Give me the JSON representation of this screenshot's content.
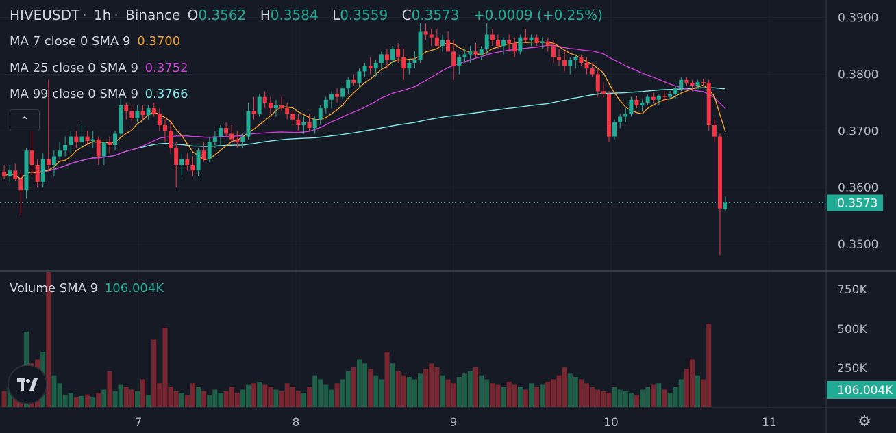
{
  "header": {
    "symbol": "HIVEUSDT",
    "interval": "1h",
    "exchange": "Binance",
    "o_label": "O",
    "open": "0.3562",
    "h_label": "H",
    "high": "0.3584",
    "l_label": "L",
    "low": "0.3559",
    "c_label": "C",
    "close": "0.3573",
    "change": "+0.0009 (+0.25%)"
  },
  "indicators": {
    "ma7": {
      "label": "MA 7 close 0 SMA 9",
      "value": "0.3700",
      "color": "#f0a030"
    },
    "ma25": {
      "label": "MA 25 close 0 SMA 9",
      "value": "0.3752",
      "color": "#d040d8"
    },
    "ma99": {
      "label": "MA 99 close 0 SMA 9",
      "value": "0.3766",
      "color": "#7fe8e8"
    },
    "volume": {
      "label": "Volume SMA 9",
      "value": "106.004K",
      "color": "#22ab94"
    }
  },
  "colors": {
    "up": "#22ab94",
    "down": "#f23645",
    "up_vol": "#1e5f48",
    "down_vol": "#7a2630",
    "bg": "#161a25",
    "grid": "#1f2330"
  },
  "icons": {
    "collapse": "chevron-up-icon",
    "logo": "tradingview-logo-icon",
    "settings": "gear-icon"
  },
  "chart_data": {
    "type": "candlestick",
    "price_axis": {
      "ticks": [
        "0.3900",
        "0.3800",
        "0.3700",
        "0.3600",
        "0.3500"
      ],
      "range": [
        0.3454,
        0.3931
      ],
      "last_price_label": "0.3573"
    },
    "volume_axis": {
      "ticks": [
        "750K",
        "500K",
        "250K"
      ],
      "range": [
        0,
        850000
      ],
      "last_volume_label": "106.004K"
    },
    "x_axis": {
      "ticks": [
        "7",
        "8",
        "9",
        "10",
        "11"
      ]
    },
    "candles": [
      [
        0.3628,
        0.364,
        0.3615,
        0.362
      ],
      [
        0.362,
        0.364,
        0.361,
        0.363
      ],
      [
        0.363,
        0.3642,
        0.3612,
        0.3615
      ],
      [
        0.3615,
        0.363,
        0.355,
        0.3595
      ],
      [
        0.3595,
        0.367,
        0.358,
        0.3665
      ],
      [
        0.3665,
        0.37,
        0.362,
        0.364
      ],
      [
        0.364,
        0.365,
        0.36,
        0.361
      ],
      [
        0.361,
        0.366,
        0.36,
        0.365
      ],
      [
        0.365,
        0.379,
        0.363,
        0.364
      ],
      [
        0.364,
        0.3665,
        0.362,
        0.3655
      ],
      [
        0.3655,
        0.368,
        0.365,
        0.3665
      ],
      [
        0.3665,
        0.369,
        0.3655,
        0.3675
      ],
      [
        0.3675,
        0.37,
        0.366,
        0.369
      ],
      [
        0.369,
        0.37,
        0.367,
        0.368
      ],
      [
        0.368,
        0.371,
        0.367,
        0.369
      ],
      [
        0.369,
        0.37,
        0.3675,
        0.3682
      ],
      [
        0.3682,
        0.37,
        0.367,
        0.3685
      ],
      [
        0.3685,
        0.369,
        0.364,
        0.3655
      ],
      [
        0.3655,
        0.368,
        0.364,
        0.368
      ],
      [
        0.368,
        0.369,
        0.366,
        0.3675
      ],
      [
        0.3675,
        0.37,
        0.3665,
        0.3695
      ],
      [
        0.3695,
        0.376,
        0.369,
        0.3745
      ],
      [
        0.3745,
        0.375,
        0.372,
        0.3735
      ],
      [
        0.3735,
        0.3745,
        0.3715,
        0.3722
      ],
      [
        0.3722,
        0.3745,
        0.3715,
        0.3735
      ],
      [
        0.3735,
        0.3745,
        0.372,
        0.3728
      ],
      [
        0.3728,
        0.3745,
        0.372,
        0.374
      ],
      [
        0.374,
        0.375,
        0.3725,
        0.373
      ],
      [
        0.373,
        0.374,
        0.37,
        0.371
      ],
      [
        0.371,
        0.372,
        0.368,
        0.37
      ],
      [
        0.37,
        0.3715,
        0.366,
        0.367
      ],
      [
        0.367,
        0.368,
        0.36,
        0.364
      ],
      [
        0.364,
        0.366,
        0.362,
        0.365
      ],
      [
        0.365,
        0.366,
        0.363,
        0.364
      ],
      [
        0.364,
        0.3655,
        0.362,
        0.363
      ],
      [
        0.363,
        0.367,
        0.362,
        0.3665
      ],
      [
        0.3665,
        0.368,
        0.3645,
        0.365
      ],
      [
        0.365,
        0.369,
        0.3645,
        0.368
      ],
      [
        0.368,
        0.37,
        0.367,
        0.369
      ],
      [
        0.369,
        0.371,
        0.3675,
        0.3705
      ],
      [
        0.3705,
        0.3715,
        0.369,
        0.3695
      ],
      [
        0.3695,
        0.371,
        0.368,
        0.3685
      ],
      [
        0.3685,
        0.37,
        0.367,
        0.368
      ],
      [
        0.368,
        0.3695,
        0.367,
        0.369
      ],
      [
        0.369,
        0.375,
        0.3685,
        0.3735
      ],
      [
        0.3735,
        0.376,
        0.372,
        0.373
      ],
      [
        0.373,
        0.3765,
        0.3725,
        0.376
      ],
      [
        0.376,
        0.377,
        0.374,
        0.375
      ],
      [
        0.375,
        0.376,
        0.373,
        0.374
      ],
      [
        0.374,
        0.3755,
        0.3725,
        0.3745
      ],
      [
        0.3745,
        0.376,
        0.3735,
        0.374
      ],
      [
        0.374,
        0.375,
        0.372,
        0.373
      ],
      [
        0.373,
        0.3735,
        0.371,
        0.372
      ],
      [
        0.372,
        0.373,
        0.37,
        0.371
      ],
      [
        0.371,
        0.3725,
        0.3695,
        0.3715
      ],
      [
        0.3715,
        0.373,
        0.37,
        0.3705
      ],
      [
        0.3705,
        0.3725,
        0.3695,
        0.372
      ],
      [
        0.372,
        0.3745,
        0.371,
        0.374
      ],
      [
        0.374,
        0.376,
        0.373,
        0.3755
      ],
      [
        0.3755,
        0.377,
        0.374,
        0.3765
      ],
      [
        0.3765,
        0.3775,
        0.375,
        0.376
      ],
      [
        0.376,
        0.378,
        0.3755,
        0.3775
      ],
      [
        0.3775,
        0.3795,
        0.3765,
        0.379
      ],
      [
        0.379,
        0.38,
        0.378,
        0.3785
      ],
      [
        0.3785,
        0.381,
        0.3775,
        0.3805
      ],
      [
        0.3805,
        0.382,
        0.3795,
        0.3815
      ],
      [
        0.3815,
        0.383,
        0.38,
        0.381
      ],
      [
        0.381,
        0.3825,
        0.3795,
        0.382
      ],
      [
        0.382,
        0.384,
        0.381,
        0.3835
      ],
      [
        0.3835,
        0.3845,
        0.381,
        0.3825
      ],
      [
        0.3825,
        0.385,
        0.3815,
        0.3845
      ],
      [
        0.3845,
        0.3855,
        0.382,
        0.383
      ],
      [
        0.383,
        0.3845,
        0.379,
        0.381
      ],
      [
        0.381,
        0.3825,
        0.38,
        0.382
      ],
      [
        0.382,
        0.384,
        0.381,
        0.3825
      ],
      [
        0.3825,
        0.389,
        0.382,
        0.3875
      ],
      [
        0.3875,
        0.389,
        0.386,
        0.387
      ],
      [
        0.387,
        0.388,
        0.385,
        0.3865
      ],
      [
        0.3865,
        0.388,
        0.3855,
        0.385
      ],
      [
        0.385,
        0.387,
        0.384,
        0.386
      ],
      [
        0.386,
        0.3875,
        0.3845,
        0.384
      ],
      [
        0.384,
        0.386,
        0.379,
        0.3815
      ],
      [
        0.3815,
        0.3835,
        0.38,
        0.383
      ],
      [
        0.383,
        0.3845,
        0.382,
        0.3835
      ],
      [
        0.3835,
        0.385,
        0.382,
        0.384
      ],
      [
        0.384,
        0.3855,
        0.383,
        0.3835
      ],
      [
        0.3835,
        0.385,
        0.3825,
        0.3845
      ],
      [
        0.3845,
        0.389,
        0.3835,
        0.387
      ],
      [
        0.387,
        0.388,
        0.385,
        0.386
      ],
      [
        0.386,
        0.387,
        0.3845,
        0.385
      ],
      [
        0.385,
        0.3865,
        0.3835,
        0.386
      ],
      [
        0.386,
        0.387,
        0.384,
        0.3855
      ],
      [
        0.3855,
        0.3865,
        0.383,
        0.384
      ],
      [
        0.384,
        0.387,
        0.3835,
        0.3865
      ],
      [
        0.3865,
        0.388,
        0.3855,
        0.386
      ],
      [
        0.386,
        0.387,
        0.385,
        0.3865
      ],
      [
        0.3865,
        0.387,
        0.385,
        0.3855
      ],
      [
        0.3855,
        0.3865,
        0.3845,
        0.3858
      ],
      [
        0.3858,
        0.3865,
        0.384,
        0.385
      ],
      [
        0.385,
        0.386,
        0.382,
        0.383
      ],
      [
        0.383,
        0.3845,
        0.3815,
        0.3825
      ],
      [
        0.3825,
        0.384,
        0.3805,
        0.3815
      ],
      [
        0.3815,
        0.383,
        0.38,
        0.3825
      ],
      [
        0.3825,
        0.3835,
        0.381,
        0.383
      ],
      [
        0.383,
        0.3835,
        0.3815,
        0.382
      ],
      [
        0.382,
        0.383,
        0.38,
        0.381
      ],
      [
        0.381,
        0.382,
        0.3795,
        0.38
      ],
      [
        0.38,
        0.381,
        0.376,
        0.377
      ],
      [
        0.377,
        0.3785,
        0.376,
        0.3765
      ],
      [
        0.3765,
        0.377,
        0.368,
        0.369
      ],
      [
        0.369,
        0.372,
        0.3685,
        0.3715
      ],
      [
        0.3715,
        0.373,
        0.3705,
        0.3725
      ],
      [
        0.3725,
        0.374,
        0.3715,
        0.373
      ],
      [
        0.373,
        0.376,
        0.3725,
        0.3755
      ],
      [
        0.3755,
        0.3762,
        0.374,
        0.3745
      ],
      [
        0.3745,
        0.3755,
        0.3735,
        0.375
      ],
      [
        0.375,
        0.3765,
        0.3745,
        0.376
      ],
      [
        0.376,
        0.3768,
        0.375,
        0.3755
      ],
      [
        0.3755,
        0.3765,
        0.3745,
        0.3762
      ],
      [
        0.3762,
        0.377,
        0.3752,
        0.376
      ],
      [
        0.376,
        0.377,
        0.3755,
        0.3765
      ],
      [
        0.3765,
        0.378,
        0.3758,
        0.3775
      ],
      [
        0.3775,
        0.3795,
        0.377,
        0.379
      ],
      [
        0.379,
        0.3795,
        0.378,
        0.3785
      ],
      [
        0.3785,
        0.379,
        0.377,
        0.378
      ],
      [
        0.378,
        0.379,
        0.3775,
        0.3786
      ],
      [
        0.3786,
        0.3792,
        0.378,
        0.3785
      ],
      [
        0.3785,
        0.379,
        0.37,
        0.371
      ],
      [
        0.371,
        0.372,
        0.368,
        0.369
      ],
      [
        0.369,
        0.3695,
        0.348,
        0.3563
      ],
      [
        0.3562,
        0.3584,
        0.3559,
        0.3573
      ]
    ],
    "volumes": [
      20,
      25,
      40,
      30,
      95,
      55,
      60,
      70,
      170,
      40,
      30,
      15,
      18,
      12,
      14,
      16,
      12,
      18,
      22,
      45,
      20,
      28,
      25,
      22,
      20,
      35,
      15,
      85,
      30,
      100,
      25,
      20,
      18,
      15,
      30,
      25,
      20,
      15,
      22,
      18,
      20,
      25,
      18,
      22,
      28,
      30,
      32,
      28,
      25,
      22,
      20,
      30,
      25,
      20,
      18,
      25,
      40,
      35,
      28,
      22,
      30,
      35,
      45,
      50,
      60,
      55,
      48,
      40,
      35,
      70,
      55,
      45,
      40,
      38,
      35,
      42,
      48,
      55,
      50,
      40,
      35,
      30,
      38,
      42,
      45,
      50,
      40,
      35,
      30,
      28,
      25,
      32,
      28,
      25,
      22,
      30,
      25,
      28,
      32,
      35,
      40,
      50,
      42,
      38,
      35,
      30,
      25,
      22,
      20,
      18,
      25,
      22,
      20,
      18,
      15,
      22,
      25,
      28,
      30,
      22,
      18,
      25,
      35,
      48,
      60,
      40,
      35,
      105
    ]
  }
}
